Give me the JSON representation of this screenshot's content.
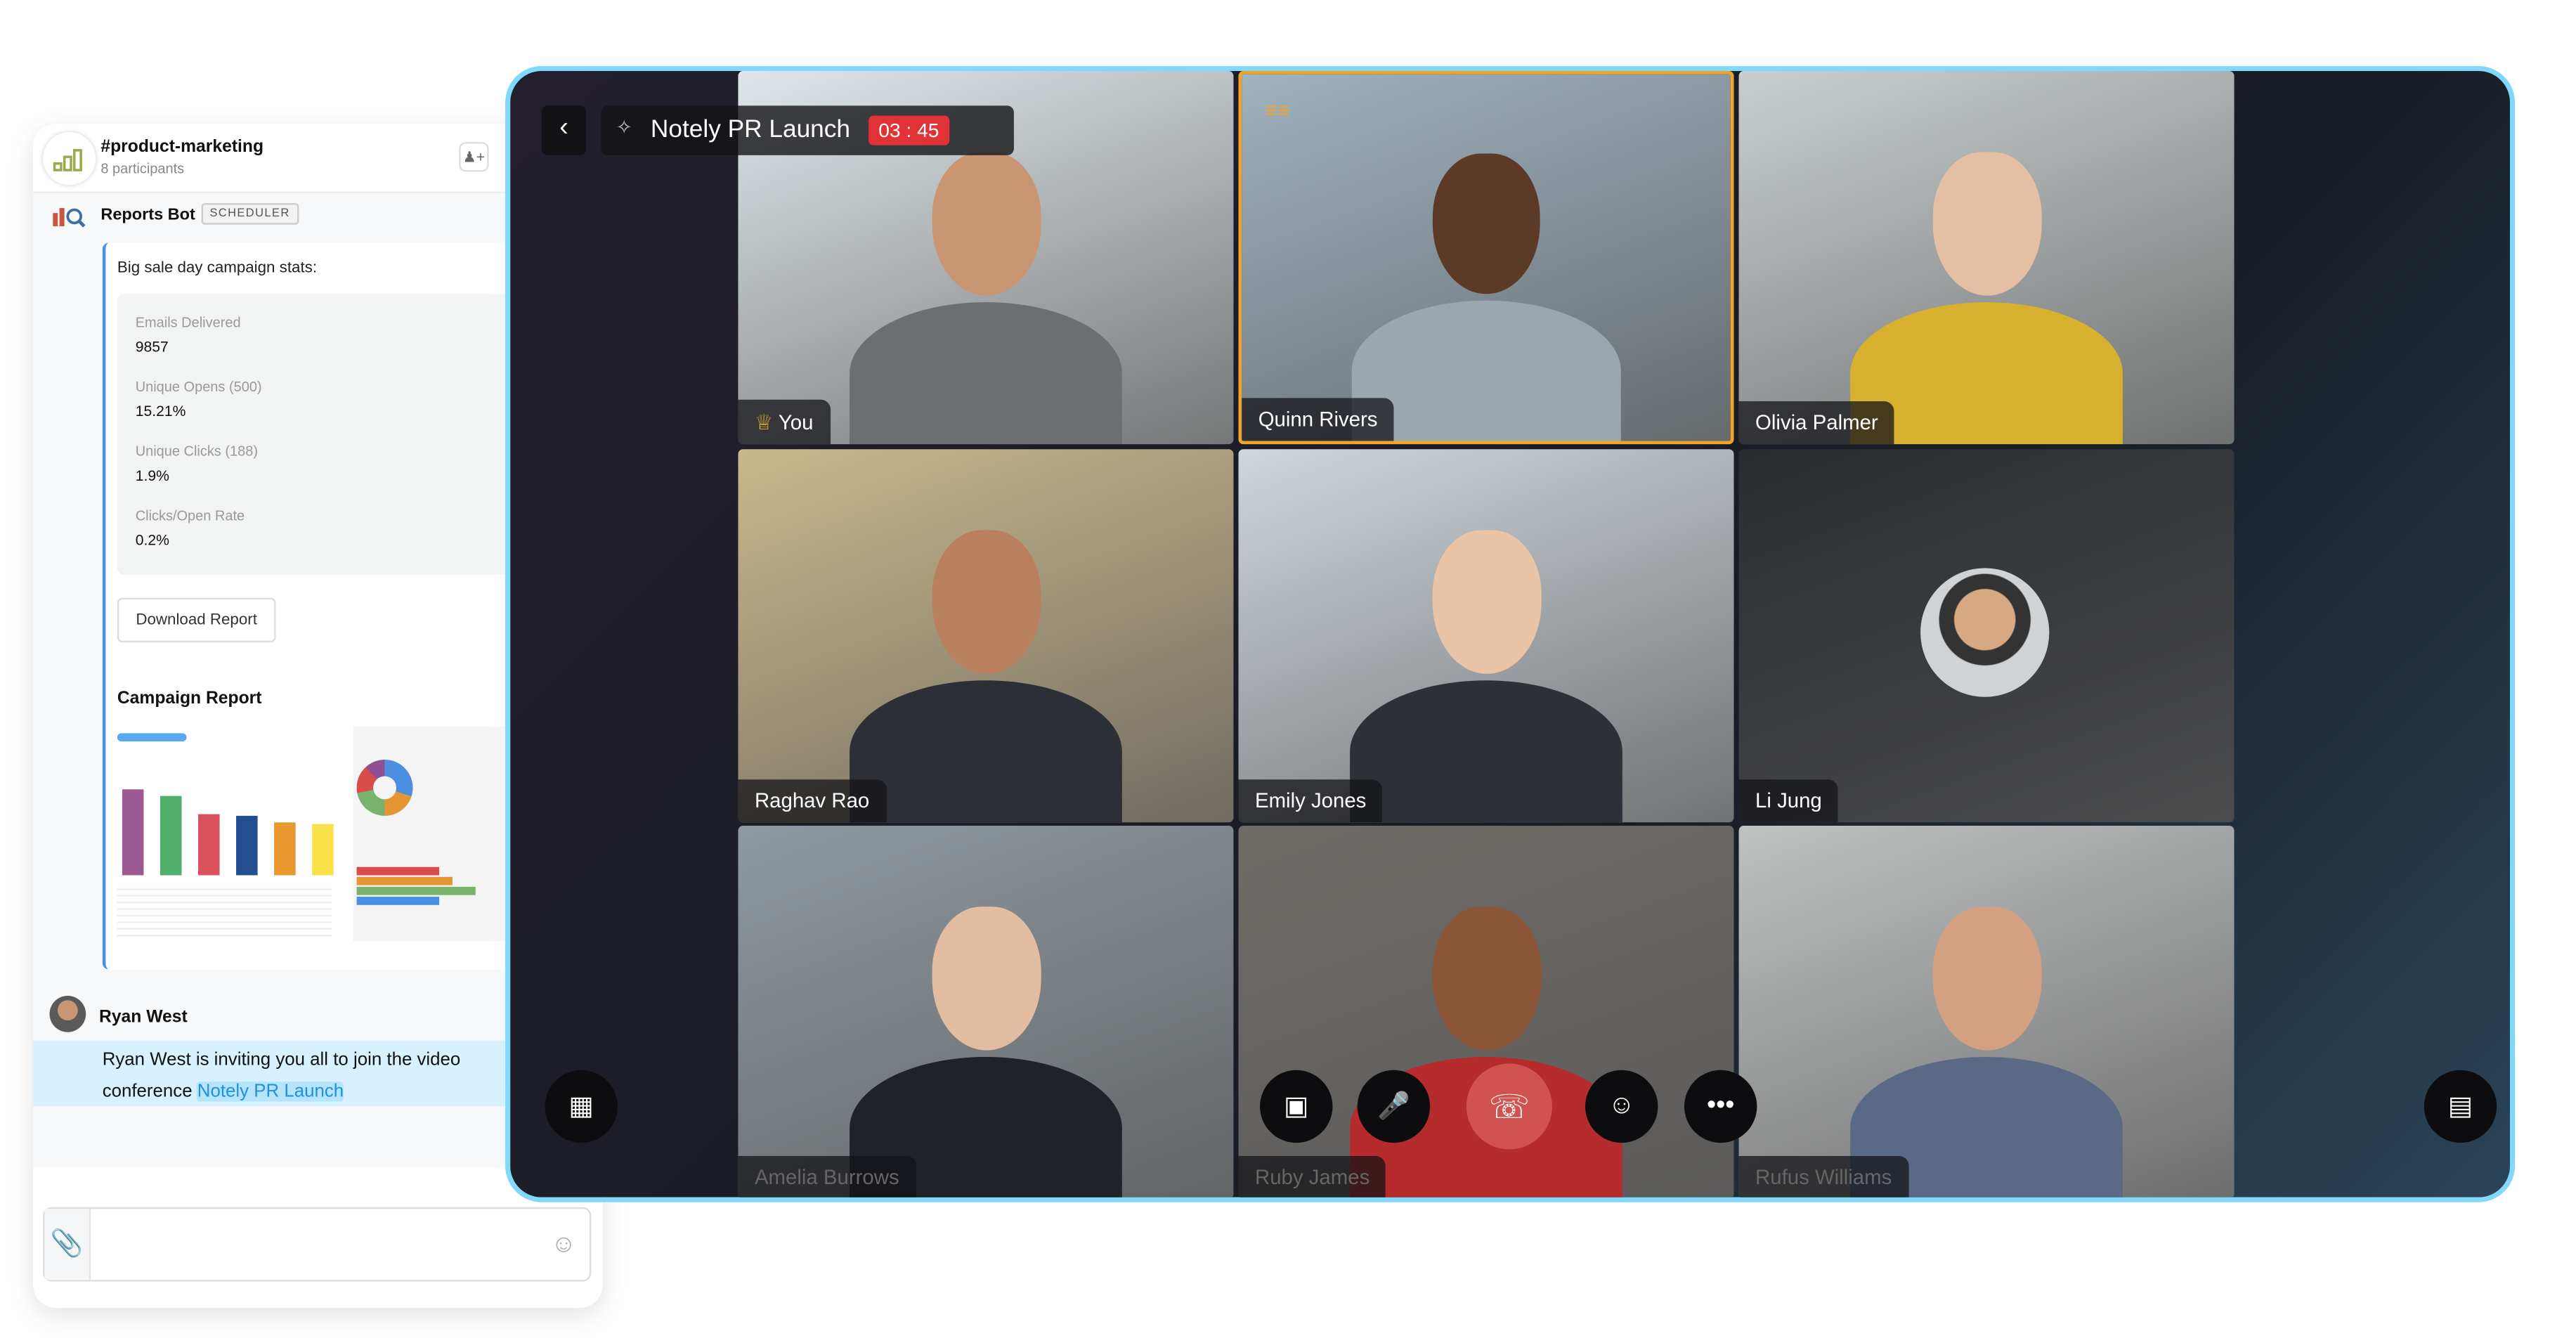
{
  "chat": {
    "channel": "#product-marketing",
    "participants": "8 participants",
    "bot_name": "Reports Bot",
    "bot_badge": "SCHEDULER",
    "card_title": "Big sale day campaign stats:",
    "stats": [
      {
        "label": "Emails Delivered",
        "value": "9857"
      },
      {
        "label": "Unique Opens (500)",
        "value": "15.21%"
      },
      {
        "label": "Unique Clicks (188)",
        "value": "1.9%"
      },
      {
        "label": "Clicks/Open Rate",
        "value": "0.2%"
      }
    ],
    "download_label": "Download Report",
    "report_title": "Campaign Report",
    "report_bar_colors": [
      "#9b5a94",
      "#4fae6a",
      "#d9515c",
      "#234e92",
      "#e9972f",
      "#f9e14a"
    ],
    "sender": "Ryan West",
    "invite_text": "Ryan West is inviting you all to join the video conference ",
    "invite_link": "Notely PR Launch"
  },
  "meeting": {
    "title": "Notely PR Launch",
    "timer": "03 : 45",
    "accent": "#80d8fc",
    "end_color": "#d25250",
    "participants": [
      {
        "name": "You",
        "bg": "#dfe6ea",
        "skin": "#c99673",
        "shirt": "#6d6e70"
      },
      {
        "name": "Quinn Rivers",
        "bg": "#9fb2bf",
        "skin": "#5b3a28",
        "shirt": "#9aa7ad"
      },
      {
        "name": "Olivia Palmer",
        "bg": "#c9cfcf",
        "skin": "#e5bfa3",
        "shirt": "#d8b02f"
      },
      {
        "name": "Raghav Rao",
        "bg": "#c9b88c",
        "skin": "#b98060",
        "shirt": "#2c2f36"
      },
      {
        "name": "Emily Jones",
        "bg": "#cfd6dc",
        "skin": "#eac4a6",
        "shirt": "#2d3036"
      },
      {
        "name": "Li Jung",
        "bg": "#2a2c30",
        "skin": "#d7a982",
        "shirt": "#2a2c30"
      },
      {
        "name": "Amelia Burrows",
        "bg": "#8f99a0",
        "skin": "#e3bda2",
        "shirt": "#1f2228"
      },
      {
        "name": "Ruby James",
        "bg": "#6f6b67",
        "skin": "#8a5637",
        "shirt": "#b62b2b"
      },
      {
        "name": "Rufus Williams",
        "bg": "#bfc1c2",
        "skin": "#d3a182",
        "shirt": "#5a6a86"
      }
    ]
  }
}
